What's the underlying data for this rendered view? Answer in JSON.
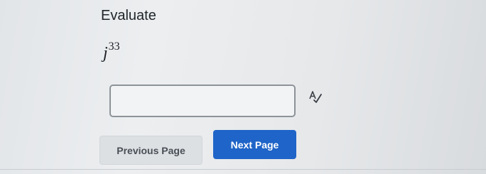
{
  "question": {
    "prompt": "Evaluate",
    "expression_base": "j",
    "expression_exponent": "33"
  },
  "answer": {
    "value": "",
    "placeholder": ""
  },
  "icons": {
    "spell_check": "spell-check-icon"
  },
  "navigation": {
    "previous_label": "Previous Page",
    "next_label": "Next Page"
  },
  "colors": {
    "next_button": "#1f64c8",
    "previous_button": "#dde0e3"
  }
}
